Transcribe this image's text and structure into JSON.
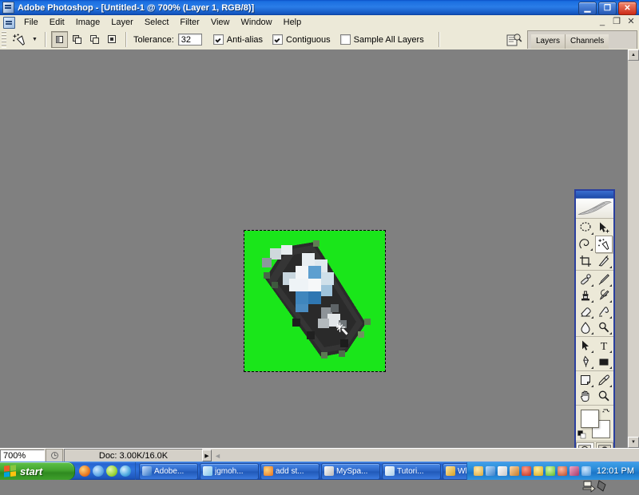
{
  "window": {
    "title": "Adobe Photoshop - [Untitled-1 @ 700% (Layer 1, RGB/8)]",
    "app_icon": "photoshop-icon",
    "minimize": "_",
    "maximize": "□",
    "close": "✕",
    "doc_minimize": "_",
    "doc_restore": "❐",
    "doc_close": "✕"
  },
  "menu": {
    "items": [
      {
        "label": "File"
      },
      {
        "label": "Edit"
      },
      {
        "label": "Image"
      },
      {
        "label": "Layer"
      },
      {
        "label": "Select"
      },
      {
        "label": "Filter"
      },
      {
        "label": "View"
      },
      {
        "label": "Window"
      },
      {
        "label": "Help"
      }
    ]
  },
  "options_bar": {
    "tool": "magic-wand-tool",
    "selection_modes": [
      {
        "name": "new-selection",
        "active": true
      },
      {
        "name": "add-to-selection",
        "active": false
      },
      {
        "name": "subtract-from-selection",
        "active": false
      },
      {
        "name": "intersect-with-selection",
        "active": false
      }
    ],
    "tolerance_label": "Tolerance:",
    "tolerance_value": "32",
    "anti_alias_label": "Anti-alias",
    "anti_alias_checked": true,
    "contiguous_label": "Contiguous",
    "contiguous_checked": true,
    "sample_all_layers_label": "Sample All Layers",
    "sample_all_layers_checked": false,
    "palette_well": {
      "tabs": [
        {
          "label": "Layers"
        },
        {
          "label": "Channels"
        }
      ]
    }
  },
  "toolbox": {
    "tools": [
      {
        "name": "marquee-tool",
        "row": 0,
        "col": 0,
        "selected": false
      },
      {
        "name": "move-tool",
        "row": 0,
        "col": 1,
        "selected": false
      },
      {
        "name": "lasso-tool",
        "row": 1,
        "col": 0,
        "selected": false
      },
      {
        "name": "magic-wand-tool",
        "row": 1,
        "col": 1,
        "selected": true
      },
      {
        "name": "crop-tool",
        "row": 2,
        "col": 0,
        "selected": false
      },
      {
        "name": "slice-tool",
        "row": 2,
        "col": 1,
        "selected": false
      },
      {
        "name": "healing-brush-tool",
        "row": 3,
        "col": 0,
        "selected": false
      },
      {
        "name": "brush-tool",
        "row": 3,
        "col": 1,
        "selected": false
      },
      {
        "name": "clone-stamp-tool",
        "row": 4,
        "col": 0,
        "selected": false
      },
      {
        "name": "history-brush-tool",
        "row": 4,
        "col": 1,
        "selected": false
      },
      {
        "name": "eraser-tool",
        "row": 5,
        "col": 0,
        "selected": false
      },
      {
        "name": "gradient-tool",
        "row": 5,
        "col": 1,
        "selected": false
      },
      {
        "name": "blur-tool",
        "row": 6,
        "col": 0,
        "selected": false
      },
      {
        "name": "dodge-tool",
        "row": 6,
        "col": 1,
        "selected": false
      },
      {
        "name": "path-selection-tool",
        "row": 7,
        "col": 0,
        "selected": false
      },
      {
        "name": "type-tool",
        "row": 7,
        "col": 1,
        "selected": false
      },
      {
        "name": "pen-tool",
        "row": 8,
        "col": 0,
        "selected": false
      },
      {
        "name": "rectangle-tool",
        "row": 8,
        "col": 1,
        "selected": false
      },
      {
        "name": "notes-tool",
        "row": 9,
        "col": 0,
        "selected": false
      },
      {
        "name": "eyedropper-tool",
        "row": 9,
        "col": 1,
        "selected": false
      },
      {
        "name": "hand-tool",
        "row": 10,
        "col": 0,
        "selected": false
      },
      {
        "name": "zoom-tool",
        "row": 10,
        "col": 1,
        "selected": false
      }
    ],
    "foreground_color": "#ffffff",
    "background_color": "#ffffff",
    "quick_mask": [
      {
        "name": "standard-mode",
        "active": true
      },
      {
        "name": "quick-mask-mode",
        "active": false
      }
    ],
    "screen_modes": [
      {
        "name": "standard-screen-mode",
        "active": true
      },
      {
        "name": "full-screen-with-menubar-mode",
        "active": false
      },
      {
        "name": "full-screen-mode",
        "active": false
      }
    ],
    "jump_to": "jump-to-imageready"
  },
  "document": {
    "canvas_background": "#1ae61a",
    "selection": "marching-ants",
    "cursor": "magic-wand-cursor",
    "zoom": "700%"
  },
  "status_bar": {
    "zoom_value": "700%",
    "doc_info": "Doc: 3.00K/16.0K",
    "arrow": "▶"
  },
  "taskbar": {
    "start_label": "start",
    "quick_launch": [
      {
        "name": "firefox-icon",
        "color": "#e8721c"
      },
      {
        "name": "internet-explorer-icon",
        "color": "#5fa8e8"
      },
      {
        "name": "msn-icon",
        "color": "#9ad43a"
      },
      {
        "name": "browser-icon",
        "color": "#4ba8e0"
      }
    ],
    "tasks": [
      {
        "label": "Adobe...",
        "icon_color": "#2b6fc4",
        "name": "taskbar-item-adobe"
      },
      {
        "label": "jgmoh...",
        "icon_color": "#7fc4e8",
        "name": "taskbar-item-jgmoh"
      },
      {
        "label": "add st...",
        "icon_color": "#e8721c",
        "name": "taskbar-item-add-st"
      },
      {
        "label": "MySpa...",
        "icon_color": "#d8d8d8",
        "name": "taskbar-item-myspace"
      },
      {
        "label": "Tutori...",
        "icon_color": "#cfe4f4",
        "name": "taskbar-item-tutorial"
      },
      {
        "label": "White...",
        "icon_color": "#d8a020",
        "name": "taskbar-item-white"
      }
    ],
    "tray_icons": [
      {
        "name": "java-icon",
        "color": "#d8a83c"
      },
      {
        "name": "network-icon",
        "color": "#5fa8e8"
      },
      {
        "name": "pencil-icon",
        "color": "#e8e8e8"
      },
      {
        "name": "hand-icon",
        "color": "#d89a4a"
      },
      {
        "name": "antivirus-icon",
        "color": "#d04a3a"
      },
      {
        "name": "shield-icon",
        "color": "#e8c43a"
      },
      {
        "name": "messenger-icon",
        "color": "#7fd44a"
      },
      {
        "name": "media-icon",
        "color": "#c85a3a"
      },
      {
        "name": "plugin-icon",
        "color": "#c04a7a"
      },
      {
        "name": "star-icon",
        "color": "#6fb8e8"
      }
    ],
    "time": "12:01 PM"
  }
}
